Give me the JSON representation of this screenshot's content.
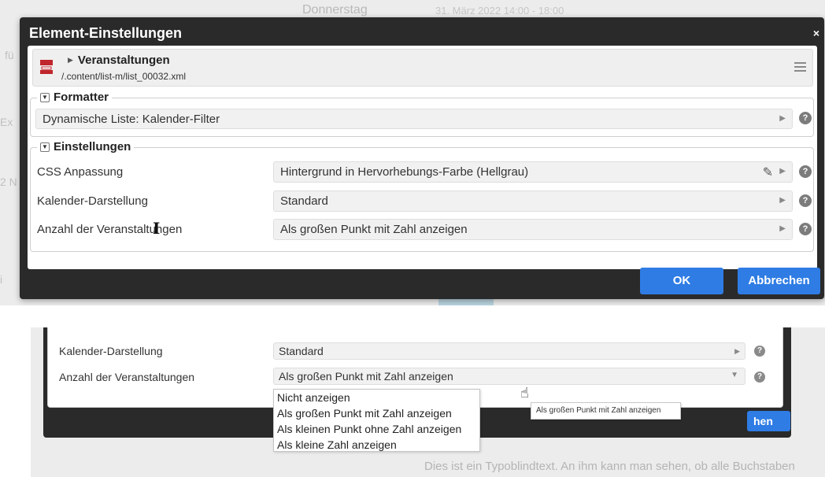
{
  "background": {
    "day": "Donnerstag",
    "datetime": "31. März 2022 14:00 - 18:00",
    "side_a": "fü",
    "side_b": "Ex",
    "side_c": "2 N",
    "side_d": "i"
  },
  "dialog": {
    "title": "Element-Einstellungen",
    "close": "×",
    "resource": {
      "title": "Veranstaltungen",
      "path": "/.content/list-m/list_00032.xml"
    },
    "formatter": {
      "legend": "Formatter",
      "value": "Dynamische Liste: Kalender-Filter"
    },
    "settings": {
      "legend": "Einstellungen",
      "rows": [
        {
          "label": "CSS Anpassung",
          "value": "Hintergrund in Hervorhebungs-Farbe (Hellgrau)"
        },
        {
          "label": "Kalender-Darstellung",
          "value": "Standard"
        },
        {
          "label": "Anzahl der Veranstaltungen",
          "value": "Als großen Punkt mit Zahl anzeigen"
        }
      ]
    },
    "ok_label": "OK",
    "cancel_label": "Abbrechen"
  },
  "zoom": {
    "row1_label": "Kalender-Darstellung",
    "row1_value": "Standard",
    "row2_label": "Anzahl der Veranstaltungen",
    "row2_value": "Als großen Punkt mit Zahl anzeigen",
    "options": [
      "Nicht anzeigen",
      "Als großen Punkt mit Zahl anzeigen",
      "Als kleinen Punkt ohne Zahl anzeigen",
      "Als kleine Zahl anzeigen"
    ],
    "tooltip": "Als großen Punkt mit Zahl anzeigen",
    "button_partial": "hen",
    "bg_text": "Dies ist ein Typoblindtext. An ihm kann man sehen, ob alle Buchstaben"
  },
  "colors": {
    "accent": "#2e7ce4",
    "dialog_bg": "#2a2a2a"
  }
}
